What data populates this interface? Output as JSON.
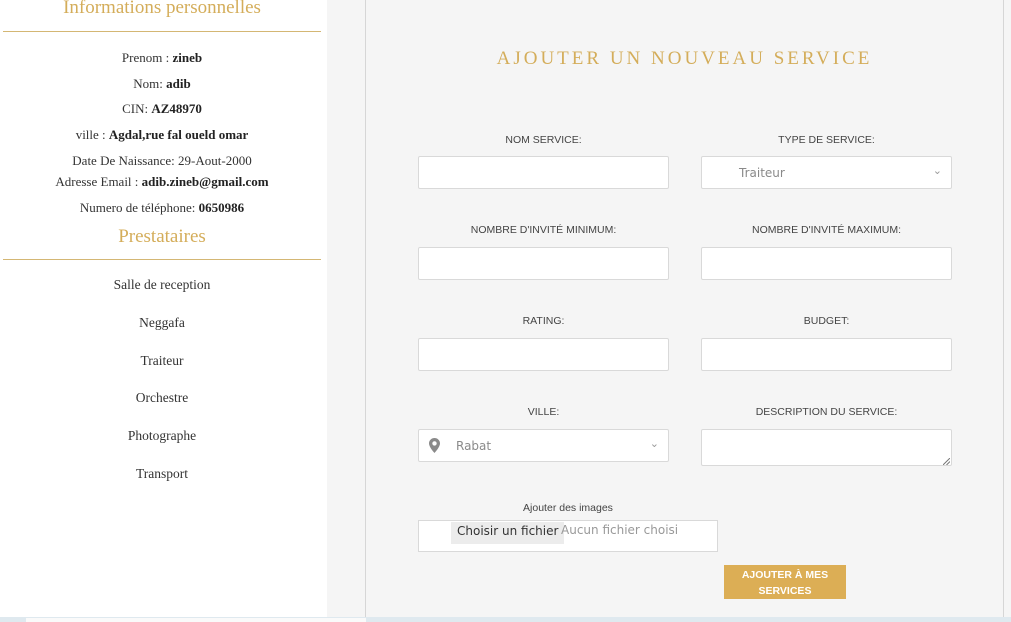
{
  "personal_info": {
    "title": "Informations personnelles",
    "lines": [
      {
        "label": "Prenom : ",
        "value": "zineb"
      },
      {
        "label": "Nom: ",
        "value": "adib"
      },
      {
        "label": "CIN: ",
        "value": "AZ48970"
      },
      {
        "label": "ville : ",
        "value": "Agdal,rue fal oueld omar"
      },
      {
        "label": "Date De Naissance: 29-Aout-2000",
        "value": ""
      },
      {
        "label": "Adresse Email : ",
        "value": "adib.zineb@gmail.com"
      },
      {
        "label": "Numero de téléphone: ",
        "value": "0650986"
      }
    ]
  },
  "prestataires": {
    "title": "Prestataires",
    "items": [
      "Salle de reception",
      "Neggafa",
      "Traiteur",
      "Orchestre",
      "Photographe",
      "Transport"
    ]
  },
  "form": {
    "title": "AJOUTER UN NOUVEAU SERVICE",
    "nom_service_label": "NOM SERVICE:",
    "type_service_label": "TYPE DE SERVICE:",
    "type_service_value": "Traiteur",
    "min_label": "NOMBRE D'INVITÉ MINIMUM:",
    "max_label": "NOMBRE D'INVITÉ MAXIMUM:",
    "rating_label": "RATING:",
    "budget_label": "BUDGET:",
    "ville_label": "VILLE:",
    "ville_value": "Rabat",
    "description_label": "DESCRIPTION DU SERVICE:",
    "images_label": "Ajouter des images",
    "file_button": "Choisir un fichier",
    "file_none": "Aucun fichier choisi",
    "submit_line1": "AJOUTER À MES",
    "submit_line2": "SERVICES"
  },
  "colors": {
    "accent": "#d4ad5a",
    "button": "#dcae55",
    "panel_bg": "#f5f5f5"
  }
}
